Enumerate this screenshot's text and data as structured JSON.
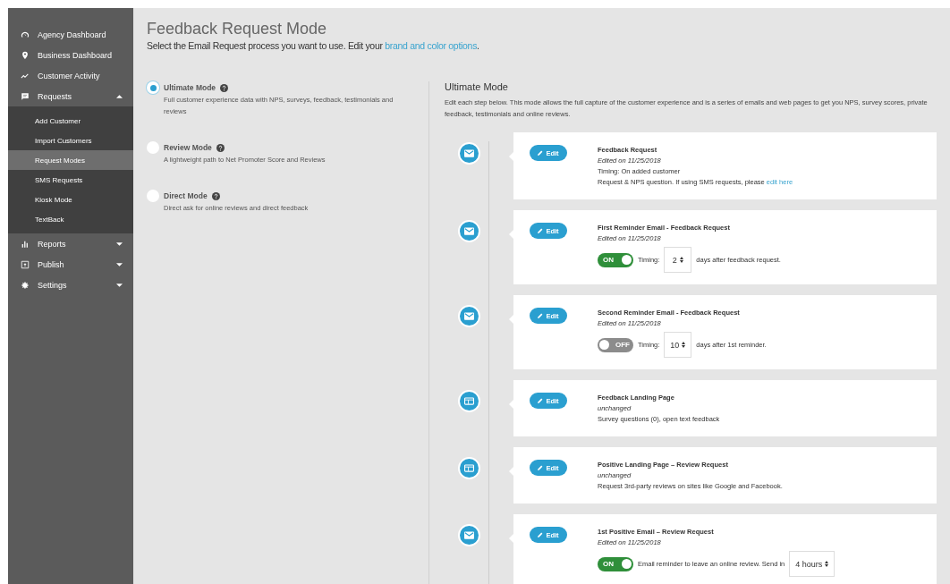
{
  "sidebar": {
    "items": [
      {
        "label": "Agency Dashboard",
        "selected": false
      },
      {
        "label": "Business Dashboard",
        "selected": false
      },
      {
        "label": "Customer Activity",
        "selected": false
      },
      {
        "label": "Requests",
        "selected": false,
        "expanded": true,
        "children": [
          {
            "label": "Add Customer",
            "selected": false
          },
          {
            "label": "Import Customers",
            "selected": false
          },
          {
            "label": "Request Modes",
            "selected": true
          },
          {
            "label": "SMS Requests",
            "selected": false
          },
          {
            "label": "Kiosk Mode",
            "selected": false
          },
          {
            "label": "TextBack",
            "selected": false
          }
        ]
      },
      {
        "label": "Reports",
        "selected": false,
        "expanded": false
      },
      {
        "label": "Publish",
        "selected": false,
        "expanded": false
      },
      {
        "label": "Settings",
        "selected": false,
        "expanded": false
      }
    ]
  },
  "page": {
    "title": "Feedback Request Mode",
    "subtitle": "Select the Email Request process you want to use. Edit your ",
    "subtitle_link": "brand and color options",
    "subtitle_end": "."
  },
  "modes": [
    {
      "label": "Ultimate Mode",
      "description": "Full customer experience data with NPS, surveys, feedback, testimonials and reviews",
      "selected": true
    },
    {
      "label": "Review Mode",
      "description": "A lightweight path to Net Promoter Score and Reviews",
      "selected": false
    },
    {
      "label": "Direct Mode",
      "description": "Direct ask for online reviews and direct feedback",
      "selected": false
    }
  ],
  "detail": {
    "title": "Ultimate Mode",
    "description": "Edit each step below. This mode allows the full capture of the customer experience and is a series of emails and web pages to get you NPS, survey scores, private feedback, testimonials and online reviews.",
    "steps": [
      {
        "kind": "email",
        "button": "Edit",
        "title": "Feedback Request",
        "status": "Edited on 11/25/2018",
        "lines": [
          "Timing: On added customer"
        ],
        "note": "Request & NPS question. If using SMS requests, please ",
        "note_link": "edit here"
      },
      {
        "kind": "email",
        "button": "Edit",
        "title": "First Reminder Email - Feedback Request",
        "status": "Edited on 11/25/2018",
        "toggle": {
          "on": true,
          "label": "ON",
          "before": "Timing:",
          "value": "2",
          "after": "days after feedback request."
        }
      },
      {
        "kind": "email",
        "button": "Edit",
        "title": "Second Reminder Email - Feedback Request",
        "status": "Edited on 11/25/2018",
        "toggle": {
          "on": false,
          "label": "OFF",
          "before": "Timing:",
          "value": "10",
          "after": "days after 1st reminder."
        }
      },
      {
        "kind": "page",
        "button": "Edit",
        "title": "Feedback Landing Page",
        "status": "unchanged",
        "lines": [
          "Survey questions (0), open text feedback"
        ]
      },
      {
        "kind": "page",
        "button": "Edit",
        "title": "Positive Landing Page – Review Request",
        "status": "unchanged",
        "lines": [
          "Request 3rd-party reviews on sites like Google and Facebook."
        ]
      },
      {
        "kind": "email",
        "button": "Edit",
        "title": "1st Positive Email – Review Request",
        "status": "Edited on 11/25/2018",
        "toggle": {
          "on": true,
          "label": "ON",
          "before": "Email reminder to leave an online review. Send in",
          "value": "4 hours"
        }
      }
    ]
  }
}
